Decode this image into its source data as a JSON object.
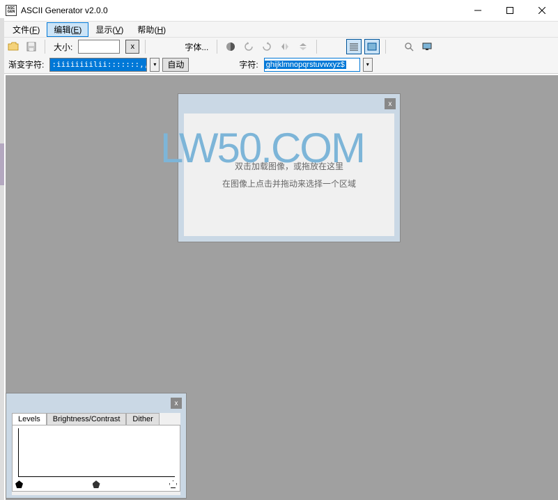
{
  "titlebar": {
    "title": "ASCII Generator v2.0.0",
    "icon_top": "ASC",
    "icon_bot": "GEN"
  },
  "menu": {
    "file": "文件",
    "file_accel": "F",
    "edit": "编辑",
    "edit_accel": "E",
    "view": "显示",
    "view_accel": "V",
    "help": "帮助",
    "help_accel": "H"
  },
  "toolbar": {
    "size_label": "大小:",
    "size_value": "",
    "x_btn": "x",
    "font_label": "字体..."
  },
  "toolbar2": {
    "gradient_label": "渐变字符:",
    "gradient_value": ":iiiiiiiilii:::::::,,,...",
    "auto_label": "自动",
    "chars_label": "字符:",
    "chars_value": "ghijklmnopqrstuvwxyz$"
  },
  "image_panel": {
    "line1": "双击加载图像，或拖放在这里",
    "line2": "在图像上点击并拖动来选择一个区域",
    "close": "x"
  },
  "levels_panel": {
    "tab_levels": "Levels",
    "tab_bc": "Brightness/Contrast",
    "tab_dither": "Dither",
    "close": "x"
  },
  "watermark": "LW50.COM",
  "icons": {
    "folder": "folder-icon",
    "save": "save-icon"
  }
}
